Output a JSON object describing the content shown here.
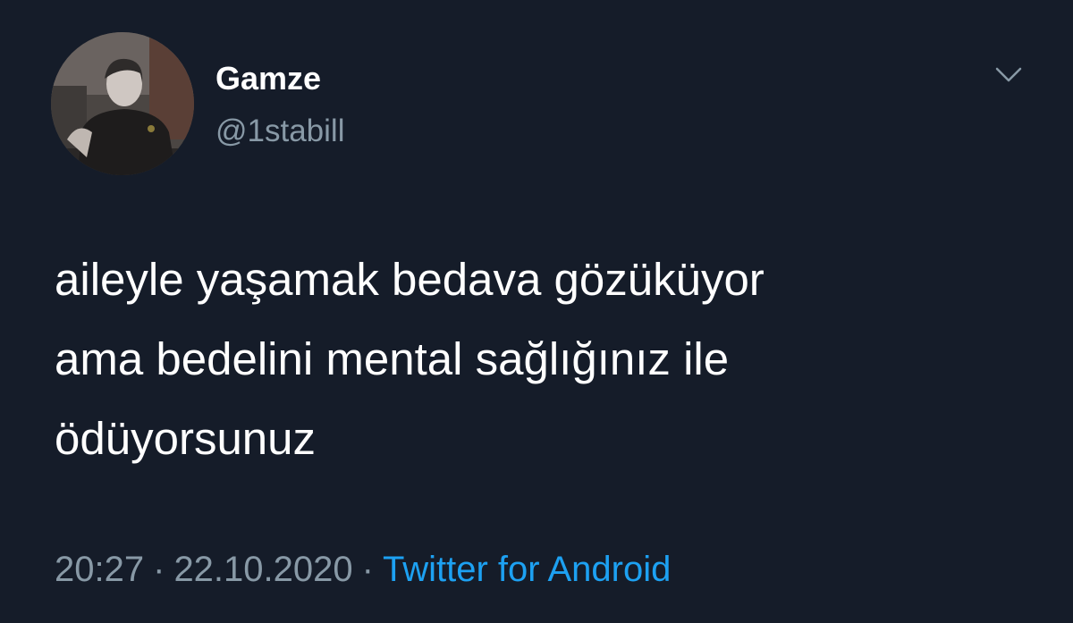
{
  "author": {
    "display_name": "Gamze",
    "handle": "@1stabill",
    "avatar_icon": "profile-photo"
  },
  "menu": {
    "icon": "chevron-down-icon"
  },
  "tweet": {
    "lines": [
      "aileyle yaşamak bedava gözüküyor",
      "ama bedelini mental sağlığınız ile",
      "ödüyorsunuz"
    ]
  },
  "meta": {
    "time": "20:27",
    "separator": "·",
    "date": "22.10.2020",
    "source": "Twitter for Android"
  },
  "colors": {
    "background": "#151c29",
    "text": "#ffffff",
    "secondary": "#8899a6",
    "link": "#1da1f2"
  }
}
